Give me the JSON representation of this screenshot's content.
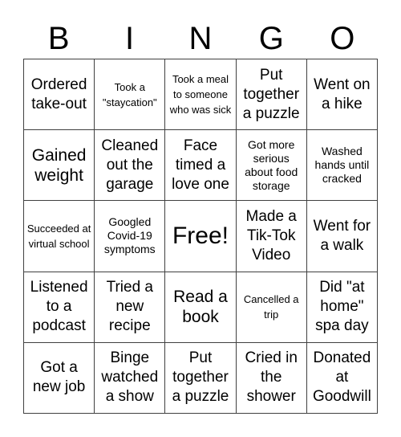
{
  "header": {
    "letters": [
      "B",
      "I",
      "N",
      "G",
      "O"
    ]
  },
  "card": {
    "rows": [
      [
        {
          "text": "Ordered take-out",
          "size": "fs-m"
        },
        {
          "text": "Took a \"staycation\"",
          "size": "fs-xxs"
        },
        {
          "text": "Took a meal to someone who was sick",
          "size": "fs-xxs"
        },
        {
          "text": "Put together a puzzle",
          "size": "fs-m"
        },
        {
          "text": "Went on a hike",
          "size": "fs-m"
        }
      ],
      [
        {
          "text": "Gained weight",
          "size": "fs-l"
        },
        {
          "text": "Cleaned out the garage",
          "size": "fs-m"
        },
        {
          "text": "Face timed a love one",
          "size": "fs-m"
        },
        {
          "text": "Got more serious about food storage",
          "size": "fs-xs"
        },
        {
          "text": "Washed hands until cracked",
          "size": "fs-xs"
        }
      ],
      [
        {
          "text": "Succeeded at virtual school",
          "size": "fs-xxs"
        },
        {
          "text": "Googled Covid-19 symptoms",
          "size": "fs-xs"
        },
        {
          "text": "Free!",
          "size": "fs-xl"
        },
        {
          "text": "Made a Tik-Tok Video",
          "size": "fs-m"
        },
        {
          "text": "Went for a walk",
          "size": "fs-m"
        }
      ],
      [
        {
          "text": "Listened to a podcast",
          "size": "fs-m"
        },
        {
          "text": "Tried a new recipe",
          "size": "fs-m"
        },
        {
          "text": "Read a book",
          "size": "fs-l"
        },
        {
          "text": "Cancelled a trip",
          "size": "fs-xxs"
        },
        {
          "text": "Did \"at home\" spa day",
          "size": "fs-m"
        }
      ],
      [
        {
          "text": "Got a new job",
          "size": "fs-m"
        },
        {
          "text": "Binge watched a show",
          "size": "fs-m"
        },
        {
          "text": "Put together a puzzle",
          "size": "fs-m"
        },
        {
          "text": "Cried in the shower",
          "size": "fs-m"
        },
        {
          "text": "Donated at Goodwill",
          "size": "fs-m"
        }
      ]
    ]
  }
}
